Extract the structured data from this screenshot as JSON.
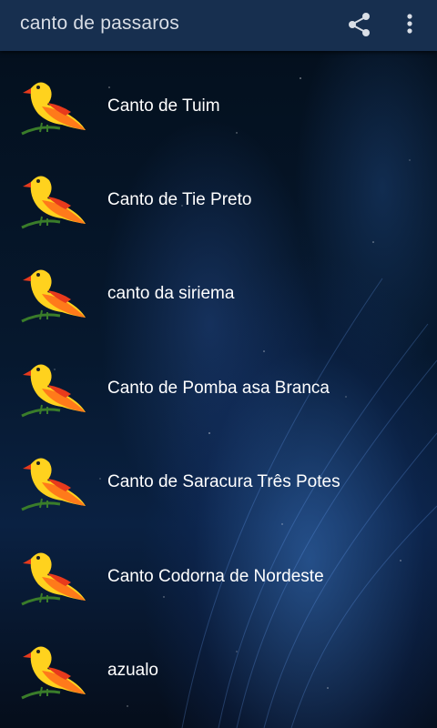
{
  "app": {
    "title": "canto de passaros",
    "share_icon": "share-icon",
    "more_icon": "more-vert-icon"
  },
  "list": {
    "icon": "bird-icon",
    "items": [
      {
        "label": "Canto de Tuim"
      },
      {
        "label": "Canto de Tie Preto"
      },
      {
        "label": "canto da siriema"
      },
      {
        "label": "Canto de Pomba asa Branca"
      },
      {
        "label": "Canto de Saracura Três Potes"
      },
      {
        "label": "Canto Codorna de Nordeste"
      },
      {
        "label": "azualo"
      }
    ]
  },
  "colors": {
    "appbar": "#172f4f",
    "title_text": "#d9dee6",
    "item_text": "#ffffff"
  }
}
